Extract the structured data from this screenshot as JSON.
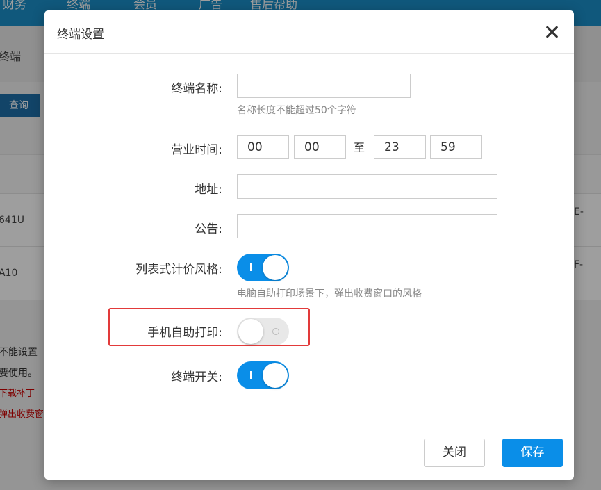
{
  "background": {
    "top_nav": [
      "财务",
      "终端",
      "会员",
      "广告",
      "售后帮助"
    ],
    "section_title": "终端",
    "query_button": "查询",
    "table_rows": [
      {
        "left": "641U",
        "right": "E-"
      },
      {
        "left": "A10",
        "right": "F-"
      }
    ],
    "notes": [
      "不能设置",
      "要使用。",
      "下载补丁",
      "弹出收费窗"
    ]
  },
  "modal": {
    "title": "终端设置",
    "fields": {
      "name": {
        "label": "终端名称:",
        "value": "",
        "help": "名称长度不能超过50个字符"
      },
      "hours": {
        "label": "营业时间:",
        "start_hour": "00",
        "start_min": "00",
        "to": "至",
        "end_hour": "23",
        "end_min": "59"
      },
      "address": {
        "label": "地址:",
        "value": ""
      },
      "notice": {
        "label": "公告:",
        "value": ""
      },
      "list_price_style": {
        "label": "列表式计价风格:",
        "on": true,
        "help": "电脑自助打印场景下，弹出收费窗口的风格"
      },
      "mobile_self_print": {
        "label": "手机自助打印:",
        "on": false
      },
      "terminal_switch": {
        "label": "终端开关:",
        "on": true
      }
    },
    "buttons": {
      "close": "关闭",
      "save": "保存"
    }
  }
}
